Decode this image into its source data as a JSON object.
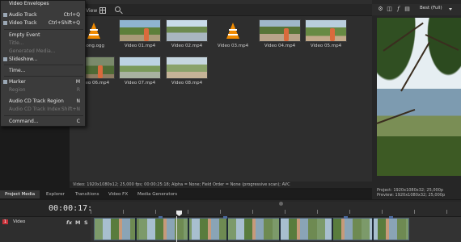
{
  "context_menu": {
    "items": [
      {
        "label": "Video Envelopes",
        "shortcut": "",
        "disabled": false
      },
      {
        "label": "Audio Track",
        "shortcut": "Ctrl+Q",
        "disabled": false
      },
      {
        "label": "Video Track",
        "shortcut": "Ctrl+Shift+Q",
        "disabled": false
      },
      {
        "label": "Empty Event",
        "shortcut": "",
        "disabled": false
      },
      {
        "label": "Title...",
        "shortcut": "",
        "disabled": true
      },
      {
        "label": "Generated Media...",
        "shortcut": "",
        "disabled": true
      },
      {
        "label": "Slideshow...",
        "shortcut": "",
        "disabled": false
      },
      {
        "label": "Time...",
        "shortcut": "",
        "disabled": false
      },
      {
        "label": "Marker",
        "shortcut": "M",
        "disabled": false
      },
      {
        "label": "Region",
        "shortcut": "R",
        "disabled": true
      },
      {
        "label": "Audio CD Track Region",
        "shortcut": "N",
        "disabled": false
      },
      {
        "label": "Audio CD Track Index",
        "shortcut": "Shift+N",
        "disabled": true
      },
      {
        "label": "Command...",
        "shortcut": "C",
        "disabled": false
      }
    ]
  },
  "media": {
    "view_label": "View",
    "items": [
      {
        "label": "Song.ogg",
        "kind": "vlc"
      },
      {
        "label": "Video 01.mp4",
        "kind": "video"
      },
      {
        "label": "Video 02.mp4",
        "kind": "video"
      },
      {
        "label": "Video 03.mp4",
        "kind": "vlc"
      },
      {
        "label": "Video 04.mp4",
        "kind": "video"
      },
      {
        "label": "Video 05.mp4",
        "kind": "video"
      },
      {
        "label": "Video 06.mp4",
        "kind": "video"
      },
      {
        "label": "Video 07.mp4",
        "kind": "video"
      },
      {
        "label": "Video 08.mp4",
        "kind": "video"
      }
    ],
    "info": "Video: 1920x1080x12; 25,000 fps; 00:00:25:18; Alpha = None; Field Order = None (progressive scan); AVC"
  },
  "tabs": [
    "Project Media",
    "Explorer",
    "Transitions",
    "Video FX",
    "Media Generators"
  ],
  "preview": {
    "quality": "Best (Full)",
    "project": "Project:  1920x1080x32; 25,000p",
    "preview": "Preview:  1920x1080x32; 25,000p"
  },
  "timeline": {
    "timecode": "00:00:17:03",
    "track_number": "1",
    "track_name": "Video",
    "buttons": {
      "fx": "fx",
      "mute": "M",
      "solo": "S"
    }
  },
  "colors": {
    "accent": "#c8323a",
    "clip_border": "#4b5f75",
    "vlc_orange": "#f08a00"
  }
}
